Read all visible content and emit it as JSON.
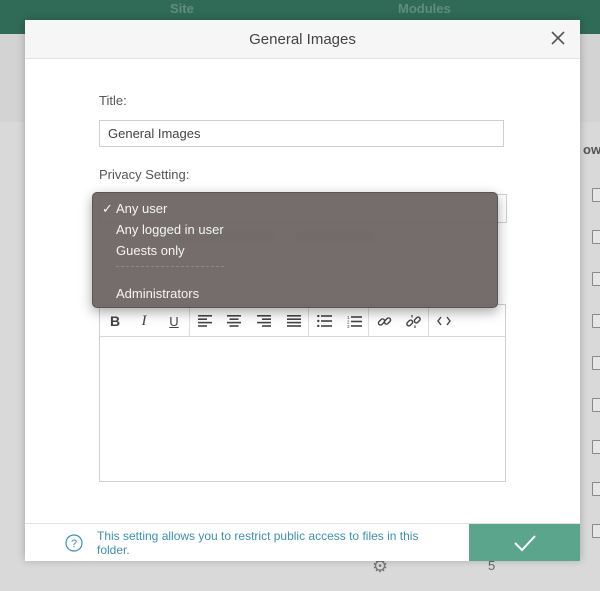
{
  "background": {
    "topbar_items": [
      "Site",
      "Modules"
    ],
    "side_label": "ow",
    "bottom_count": "5"
  },
  "modal": {
    "title": "General Images",
    "title_label": "Title:",
    "title_value": "General Images",
    "privacy_label": "Privacy Setting:",
    "privacy_selected": "Any user",
    "privacy_options": [
      {
        "label": "Any user",
        "checked": true
      },
      {
        "label": "Any logged in user",
        "checked": false
      },
      {
        "label": "Guests only",
        "checked": false
      },
      {
        "label": "Administrators",
        "checked": false
      }
    ],
    "separator_text": "-----------------",
    "help_text": "This setting allows you to restrict public access to files in this folder.",
    "toolbar_icons": [
      "bold-icon",
      "italic-icon",
      "underline-icon",
      "align-left-icon",
      "align-center-icon",
      "align-right-icon",
      "align-justify-icon",
      "bullet-list-icon",
      "numbered-list-icon",
      "link-icon",
      "unlink-icon",
      "code-icon"
    ]
  },
  "colors": {
    "accent": "#5aa58b",
    "topbar": "#2f6b57",
    "help_text": "#3e8fb0"
  }
}
